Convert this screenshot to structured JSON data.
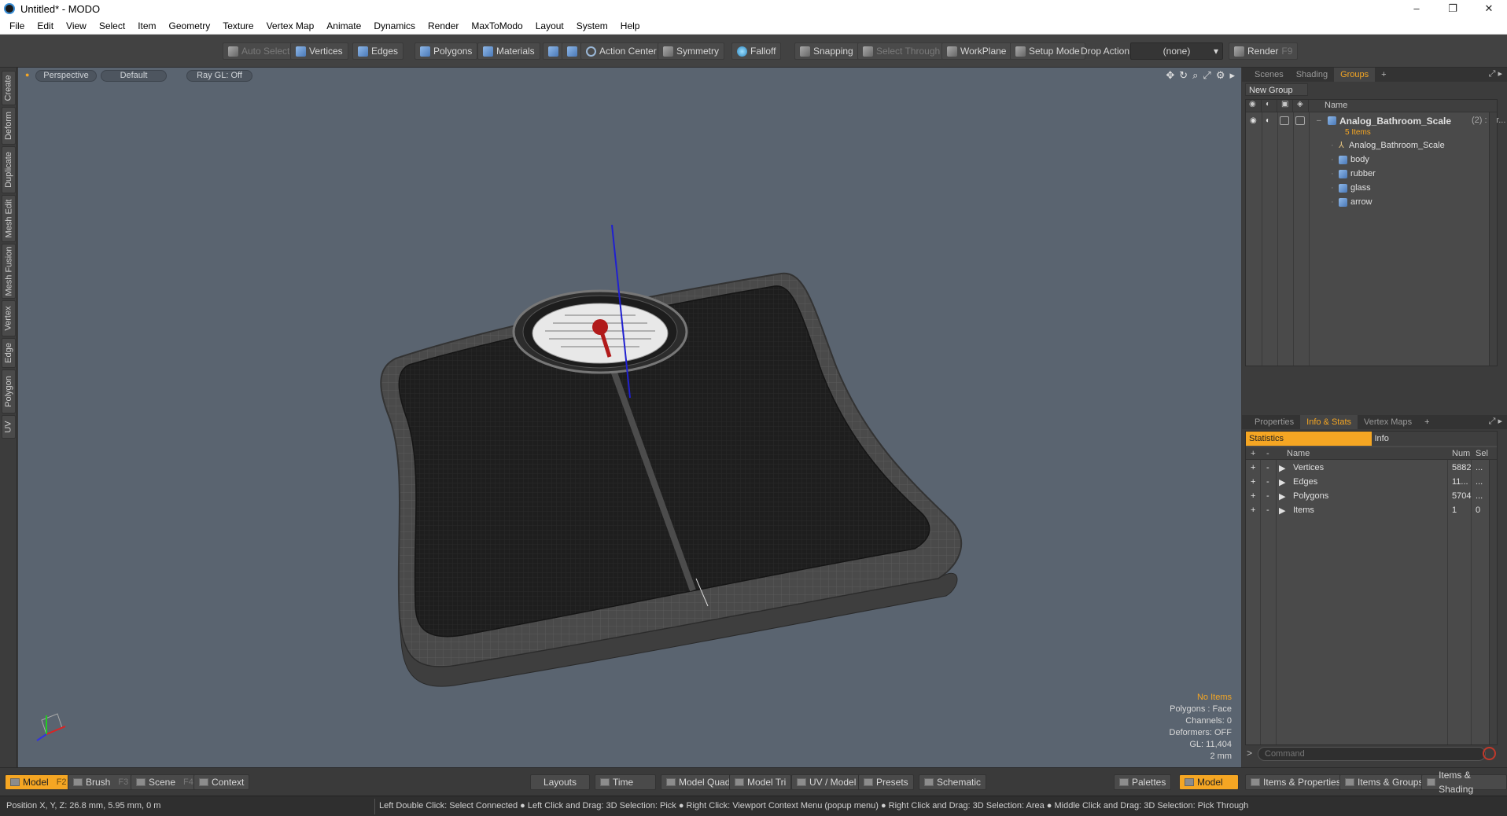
{
  "window": {
    "title": "Untitled* - MODO",
    "controls": [
      "–",
      "❐",
      "✕"
    ]
  },
  "menu": [
    "File",
    "Edit",
    "View",
    "Select",
    "Item",
    "Geometry",
    "Texture",
    "Vertex Map",
    "Animate",
    "Dynamics",
    "Render",
    "MaxToModo",
    "Layout",
    "System",
    "Help"
  ],
  "toolbar": {
    "auto_select": "Auto Select",
    "vertices": "Vertices",
    "edges": "Edges",
    "polygons": "Polygons",
    "materials": "Materials",
    "action_center": "Action Center",
    "symmetry": "Symmetry",
    "falloff": "Falloff",
    "snapping": "Snapping",
    "select_through": "Select Through",
    "workplane": "WorkPlane",
    "setup_mode": "Setup Mode",
    "drop_action_label": "Drop Action",
    "drop_action_value": "(none)",
    "render": "Render",
    "render_key": "F9"
  },
  "left_tabs": [
    "Create",
    "Deform",
    "Duplicate",
    "Mesh Edit",
    "Mesh Fusion",
    "Vertex",
    "Edge",
    "Polygon",
    "UV"
  ],
  "viewport": {
    "view": "Perspective",
    "shading": "Default",
    "raygl": "Ray GL: Off",
    "stats": {
      "no_items": "No Items",
      "polygons": "Polygons : Face",
      "channels": "Channels: 0",
      "deformers": "Deformers: OFF",
      "gl": "GL: 11,404",
      "scale": "2 mm"
    }
  },
  "groups_panel": {
    "tabs": [
      "Scenes",
      "Shading",
      "Groups"
    ],
    "active_tab": "Groups",
    "new_group": "New Group",
    "header_name": "Name",
    "group": {
      "name": "Analog_Bathroom_Scale",
      "count": "(2) : Gr...",
      "items_label": "5 Items"
    },
    "children": [
      "Analog_Bathroom_Scale",
      "body",
      "rubber",
      "glass",
      "arrow"
    ]
  },
  "stats_panel": {
    "tabs": [
      "Properties",
      "Info & Stats",
      "Vertex Maps"
    ],
    "active_tab": "Info & Stats",
    "subtabs": [
      "Statistics",
      "Info"
    ],
    "columns": {
      "name": "Name",
      "num": "Num",
      "sel": "Sel"
    },
    "rows": [
      {
        "name": "Vertices",
        "num": "5882",
        "sel": "..."
      },
      {
        "name": "Edges",
        "num": "11...",
        "sel": "..."
      },
      {
        "name": "Polygons",
        "num": "5704",
        "sel": "..."
      },
      {
        "name": "Items",
        "num": "1",
        "sel": "0"
      }
    ],
    "command_placeholder": "Command"
  },
  "bottom_bar": {
    "model": "Model",
    "model_key": "F2",
    "brush": "Brush",
    "brush_key": "F3",
    "scene": "Scene",
    "scene_key": "F4",
    "context": "Context",
    "layouts": "Layouts",
    "time": "Time",
    "model_quad": "Model Quad",
    "model_tri": "Model Tri",
    "uv_model": "UV / Model",
    "presets": "Presets",
    "schematic": "Schematic",
    "palettes": "Palettes",
    "model_right": "Model",
    "items_properties": "Items & Properties",
    "items_groups": "Items & Groups",
    "items_shading": "Items & Shading"
  },
  "status": {
    "position": "Position X, Y, Z:   26.8 mm, 5.95 mm, 0 m",
    "hints": "Left Double Click: Select Connected ● Left Click and Drag: 3D Selection: Pick ● Right Click: Viewport Context Menu (popup menu) ● Right Click and Drag: 3D Selection: Area ● Middle Click and Drag: 3D Selection: Pick Through"
  },
  "colors": {
    "accent": "#f5a623",
    "viewport_bg": "#5a6470"
  }
}
